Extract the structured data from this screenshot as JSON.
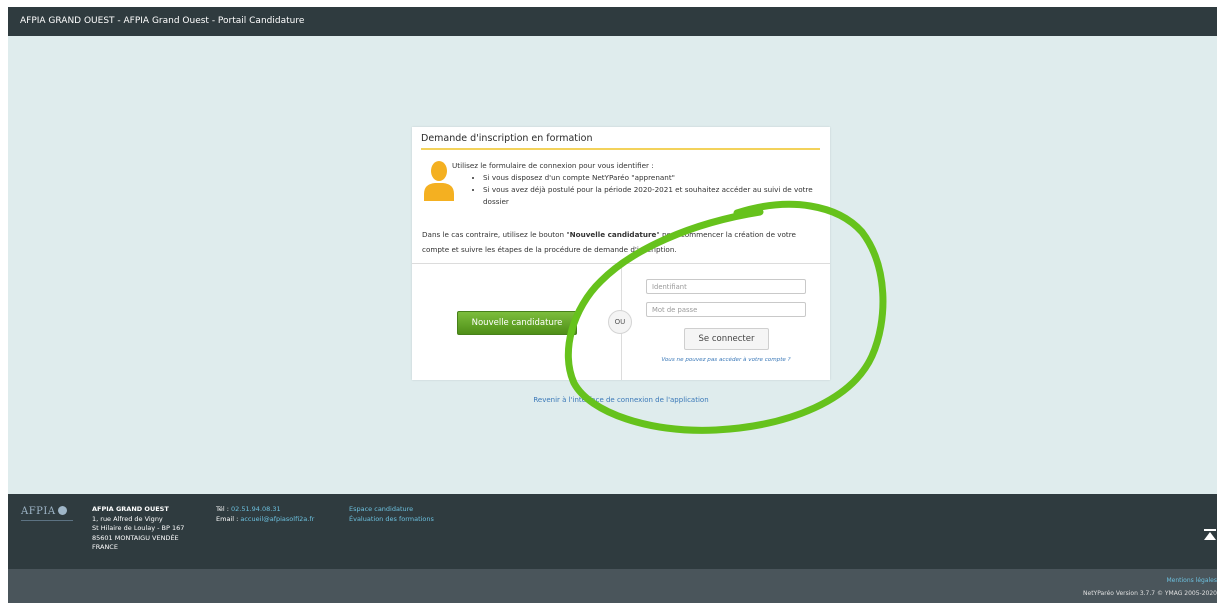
{
  "header": {
    "title": "AFPIA GRAND OUEST - AFPIA Grand Ouest - Portail Candidature"
  },
  "card": {
    "title": "Demande d'inscription en formation",
    "intro": "Utilisez le formulaire de connexion pour vous identifier :",
    "bullets": [
      "Si vous disposez d'un compte NetYParéo \"apprenant\"",
      "Si vous avez déjà postulé pour la période 2020-2021 et souhaitez accéder au suivi de votre dossier"
    ],
    "para_before": "Dans le cas contraire, utilisez le bouton \"",
    "para_bold": "Nouvelle candidature",
    "para_after": "\" pour commencer la création de votre compte et suivre les étapes de la procédure de demande d'inscription.",
    "new_button_label": "Nouvelle candidature",
    "or_label": "OU",
    "login_placeholder": "Identifiant",
    "password_placeholder": "Mot de passe",
    "connect_label": "Se connecter",
    "forgot_label": "Vous ne pouvez pas accéder à votre compte ?"
  },
  "back_link": "Revenir à l'interface de connexion de l'application",
  "footer": {
    "logo_text": "AFPIA",
    "address": [
      "AFPIA GRAND OUEST",
      "1, rue Alfred de Vigny",
      "St Hilaire de Loulay - BP 167",
      "85601 MONTAIGU VENDÉE",
      "FRANCE"
    ],
    "tel_label": "Tél : ",
    "tel_value": "02.51.94.08.31",
    "email_label": "Email : ",
    "email_value": "accueil@afpiasolfi2a.fr",
    "links": [
      "Espace candidature",
      "Évaluation des formations"
    ],
    "mentions": "Mentions légales",
    "version": "NetYParéo Version 3.7.7 © YMAG 2005-2020"
  },
  "colors": {
    "header_bg": "#2f3b3f",
    "content_bg": "#dfeced",
    "title_underline": "#f3d25b",
    "primary_green": "#5a9e22",
    "avatar_orange": "#f4b021",
    "link_blue": "#3a78b8",
    "annotation_green": "#66c21c"
  },
  "icons": {
    "avatar": "user-avatar-icon",
    "scroll_top": "scroll-to-top-icon"
  }
}
